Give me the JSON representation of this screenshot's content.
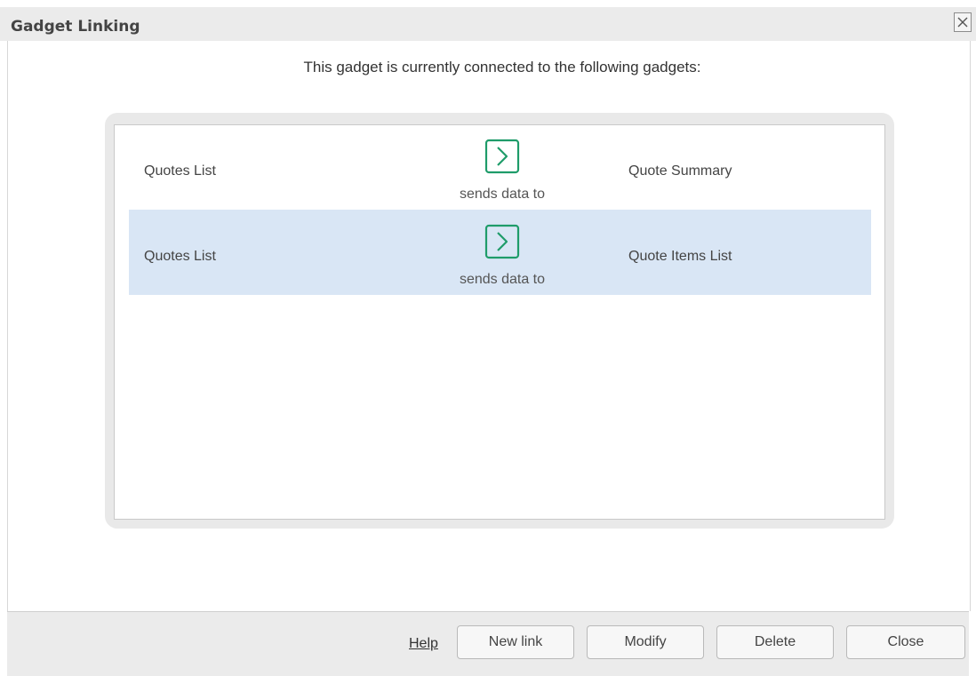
{
  "dialog": {
    "title": "Gadget Linking",
    "intro_text": "This gadget is currently connected to the following gadgets:"
  },
  "links": [
    {
      "source": "Quotes List",
      "relation": "sends data to",
      "target": "Quote Summary",
      "selected": false
    },
    {
      "source": "Quotes List",
      "relation": "sends data to",
      "target": "Quote Items List",
      "selected": true
    }
  ],
  "footer": {
    "help_label": "Help",
    "new_link_label": "New link",
    "modify_label": "Modify",
    "delete_label": "Delete",
    "close_label": "Close"
  },
  "icons": {
    "close": "close-icon",
    "link_arrow": "chevron-right-icon"
  },
  "colors": {
    "link_arrow": "#1f9c6a",
    "selected_row": "#d9e6f5",
    "titlebar": "#ebebeb"
  }
}
